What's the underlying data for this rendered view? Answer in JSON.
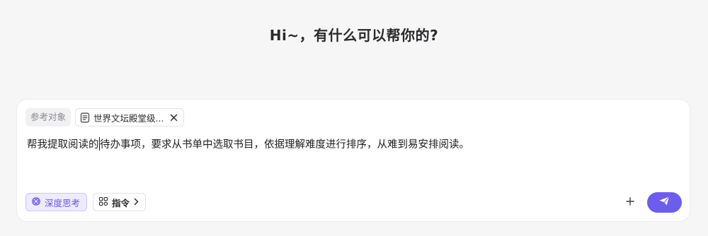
{
  "greeting": "Hi~，有什么可以帮你的?",
  "reference": {
    "label": "参考对象",
    "chip_label": "世界文坛殿堂级...",
    "chip_icon": "document-icon",
    "close_icon": "close-icon"
  },
  "prompt": {
    "before_caret": "帮我提取阅读的",
    "after_caret": "待办事项，要求从书单中选取书目，依据理解难度进行排序，从难到易安排阅读。"
  },
  "toolbar": {
    "deep_think_label": "深度思考",
    "command_label": "指令",
    "plus_icon": "plus-icon",
    "send_icon": "send-icon"
  },
  "colors": {
    "accent": "#6c5cf0",
    "accent_soft": "#eeebff",
    "background": "#f6f6f7"
  }
}
